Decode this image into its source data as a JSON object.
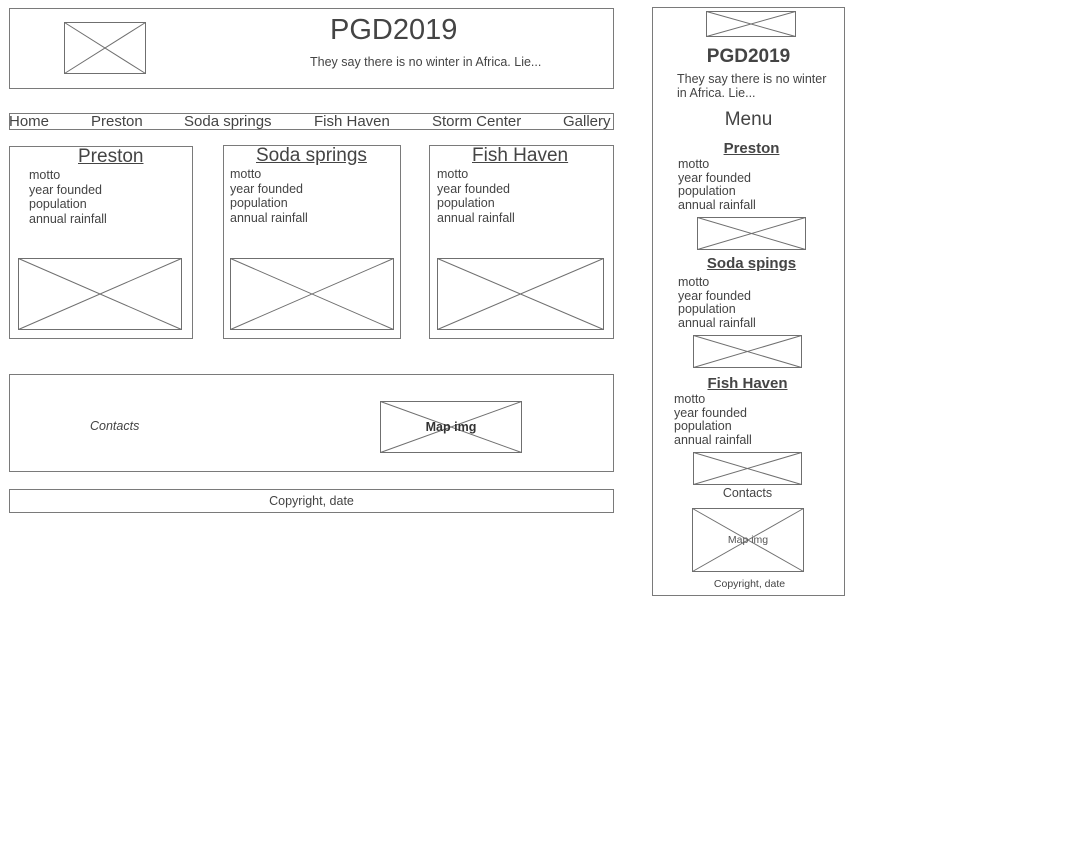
{
  "desktop": {
    "header": {
      "title": "PGD2019",
      "tagline": "They say there is no winter in Africa. Lie..."
    },
    "nav": [
      "Home",
      "Preston",
      "Soda springs",
      "Fish Haven",
      "Storm Center",
      "Gallery"
    ],
    "cards": [
      {
        "title": "Preston",
        "facts": [
          "motto",
          "year founded",
          "population",
          "annual rainfall"
        ]
      },
      {
        "title": "Soda springs",
        "facts": [
          "motto",
          "year founded",
          "population",
          "annual rainfall"
        ]
      },
      {
        "title": "Fish Haven",
        "facts": [
          "motto",
          "year founded",
          "population",
          "annual rainfall"
        ]
      }
    ],
    "contacts": "Contacts",
    "map_label": "Map img",
    "copyright": "Copyright, date"
  },
  "mobile": {
    "title": "PGD2019",
    "tagline_line1": "They say there is no winter",
    "tagline_line2": "in Africa. Lie...",
    "menu": "Menu",
    "cards": [
      {
        "title": "Preston",
        "facts": [
          "motto",
          "year founded",
          "population",
          "annual rainfall"
        ]
      },
      {
        "title": "Soda spings",
        "facts": [
          "motto",
          "year founded",
          "population",
          "annual rainfall"
        ]
      },
      {
        "title": "Fish Haven",
        "facts": [
          "motto",
          "year founded",
          "population",
          "annual rainfall"
        ]
      }
    ],
    "contacts": "Contacts",
    "map_label": "Map img",
    "copyright": "Copyright, date"
  }
}
